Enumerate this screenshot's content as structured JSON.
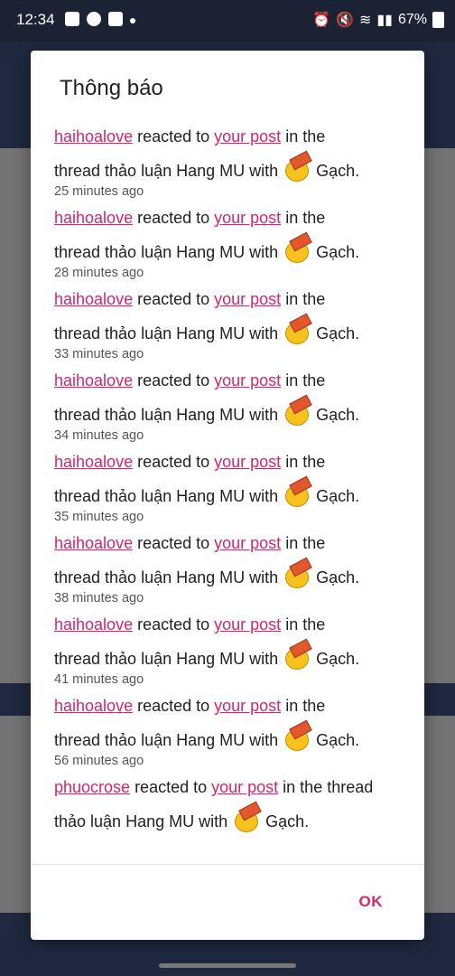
{
  "status": {
    "time": "12:34",
    "battery": "67%"
  },
  "dialog": {
    "title": "Thông báo",
    "ok_label": "OK",
    "notifications": [
      {
        "user": "haihoalove",
        "text1": " reacted to ",
        "link": "your post",
        "text2": " in the",
        "line2_pre": "thread thảo luận Hang MU with",
        "line2_post": "Gạch.",
        "time": "25 minutes ago"
      },
      {
        "user": "haihoalove",
        "text1": " reacted to ",
        "link": "your post",
        "text2": " in the",
        "line2_pre": "thread thảo luận Hang MU with",
        "line2_post": "Gạch.",
        "time": "28 minutes ago"
      },
      {
        "user": "haihoalove",
        "text1": " reacted to ",
        "link": "your post",
        "text2": " in the",
        "line2_pre": "thread thảo luận Hang MU with",
        "line2_post": "Gạch.",
        "time": "33 minutes ago"
      },
      {
        "user": "haihoalove",
        "text1": " reacted to ",
        "link": "your post",
        "text2": " in the",
        "line2_pre": "thread thảo luận Hang MU with",
        "line2_post": "Gạch.",
        "time": "34 minutes ago"
      },
      {
        "user": "haihoalove",
        "text1": " reacted to ",
        "link": "your post",
        "text2": " in the",
        "line2_pre": "thread thảo luận Hang MU with",
        "line2_post": "Gạch.",
        "time": "35 minutes ago"
      },
      {
        "user": "haihoalove",
        "text1": " reacted to ",
        "link": "your post",
        "text2": " in the",
        "line2_pre": "thread thảo luận Hang MU with",
        "line2_post": "Gạch.",
        "time": "38 minutes ago"
      },
      {
        "user": "haihoalove",
        "text1": " reacted to ",
        "link": "your post",
        "text2": " in the",
        "line2_pre": "thread thảo luận Hang MU with",
        "line2_post": "Gạch.",
        "time": "41 minutes ago"
      },
      {
        "user": "haihoalove",
        "text1": " reacted to ",
        "link": "your post",
        "text2": " in the",
        "line2_pre": "thread thảo luận Hang MU with",
        "line2_post": "Gạch.",
        "time": "56 minutes ago"
      },
      {
        "user": "phuocrose",
        "text1": " reacted to ",
        "link": "your post",
        "text2": " in the thread",
        "line2_pre": "thảo luận Hang MU with",
        "line2_post": "Gạch.",
        "time": ""
      }
    ]
  },
  "colors": {
    "accent": "#d6246f",
    "header": "#46598b"
  },
  "icons": {
    "reaction": "brick-face-emoji-icon"
  }
}
